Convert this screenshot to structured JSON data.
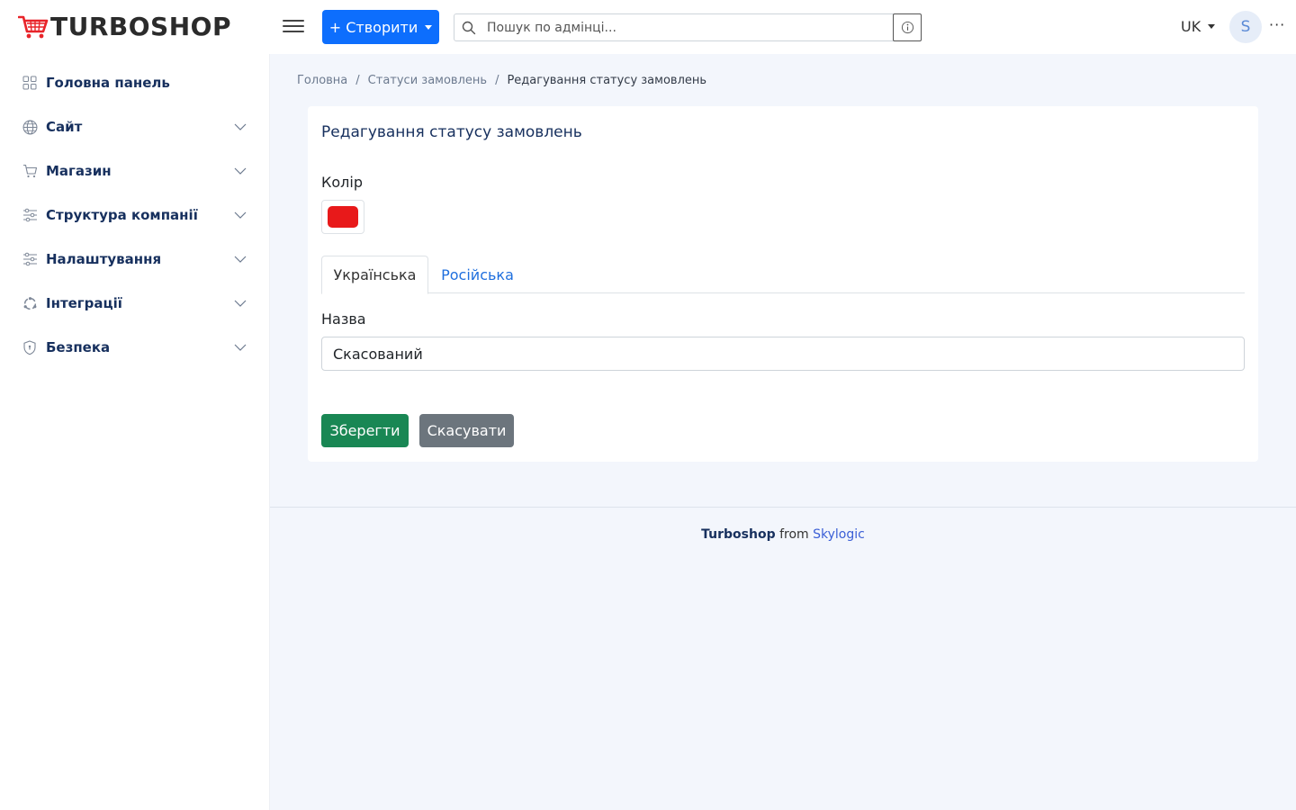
{
  "brand": {
    "name": "TURBOSHOP",
    "logo_icon": "cart-icon",
    "logo_color": "#e8242a"
  },
  "header": {
    "create_label": "+ Створити",
    "search_placeholder": "Пошук по адмінці...",
    "language": "UK",
    "avatar_initial": "S",
    "more_label": "···",
    "accent_color": "#0d6efd"
  },
  "sidebar": {
    "items": [
      {
        "label": "Головна панель",
        "icon": "dashboard-grid-icon",
        "expandable": false
      },
      {
        "label": "Сайт",
        "icon": "globe-icon",
        "expandable": true
      },
      {
        "label": "Магазин",
        "icon": "cart-icon",
        "expandable": true
      },
      {
        "label": "Структура компанії",
        "icon": "sliders-icon",
        "expandable": true
      },
      {
        "label": "Налаштування",
        "icon": "sliders-icon",
        "expandable": true
      },
      {
        "label": "Інтеграції",
        "icon": "integrations-icon",
        "expandable": true
      },
      {
        "label": "Безпека",
        "icon": "shield-icon",
        "expandable": true
      }
    ]
  },
  "breadcrumb": {
    "home": "Головна",
    "section": "Статуси замовлень",
    "current": "Редагування статусу замовлень"
  },
  "form": {
    "title": "Редагування статусу замовлень",
    "color_label": "Колір",
    "color_value": "#e8191a",
    "tabs": [
      {
        "label": "Українська",
        "active": true
      },
      {
        "label": "Російська",
        "active": false
      }
    ],
    "name_label": "Назва",
    "name_value": "Скасований",
    "save_label": "Зберегти",
    "cancel_label": "Скасувати"
  },
  "footer": {
    "brand": "Turboshop",
    "from": "from",
    "company": "Skylogic"
  }
}
